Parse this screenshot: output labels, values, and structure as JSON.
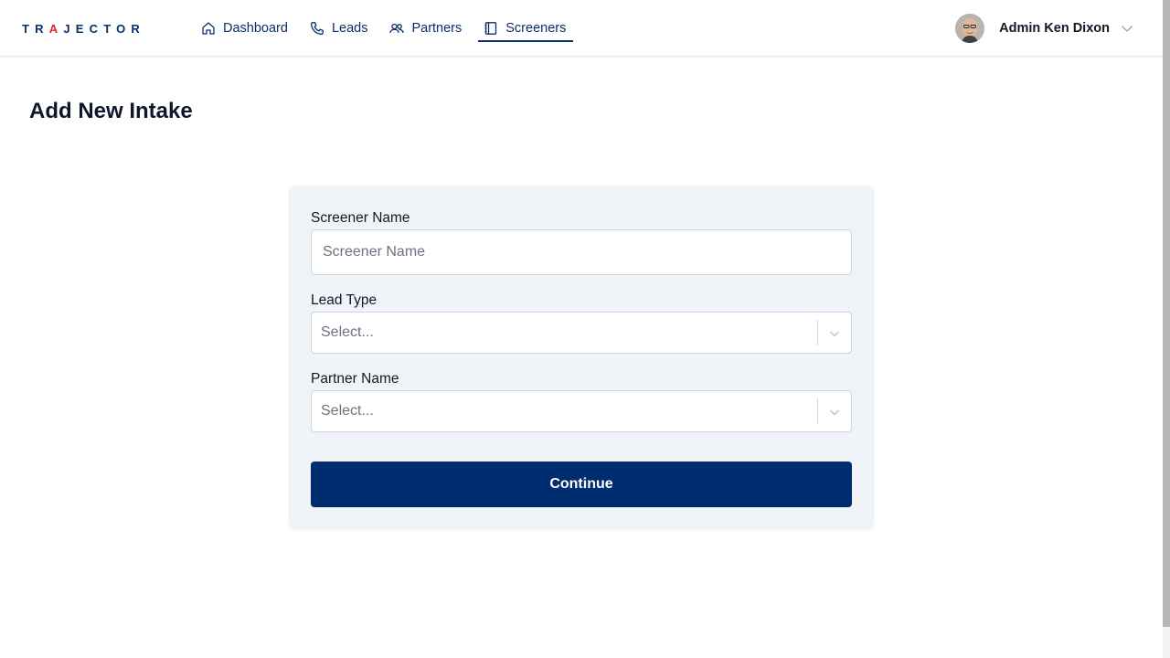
{
  "brand": {
    "logo_pre": "TR",
    "logo_mark": "A",
    "logo_post": "JECTOR",
    "color": "#0b2f6b",
    "accent": "#dc2626"
  },
  "nav": {
    "items": [
      {
        "label": "Dashboard",
        "icon": "home-icon"
      },
      {
        "label": "Leads",
        "icon": "phone-icon"
      },
      {
        "label": "Partners",
        "icon": "users-icon"
      },
      {
        "label": "Screeners",
        "icon": "notebook-icon",
        "active": true
      }
    ]
  },
  "user": {
    "name": "Admin Ken Dixon",
    "avatar_icon": "avatar"
  },
  "page": {
    "title": "Add New Intake"
  },
  "form": {
    "screener_name": {
      "label": "Screener Name",
      "placeholder": "Screener Name"
    },
    "lead_type": {
      "label": "Lead Type",
      "placeholder": "Select..."
    },
    "partner_name": {
      "label": "Partner Name",
      "placeholder": "Select..."
    },
    "continue_label": "Continue",
    "button_color": "#002d70"
  }
}
